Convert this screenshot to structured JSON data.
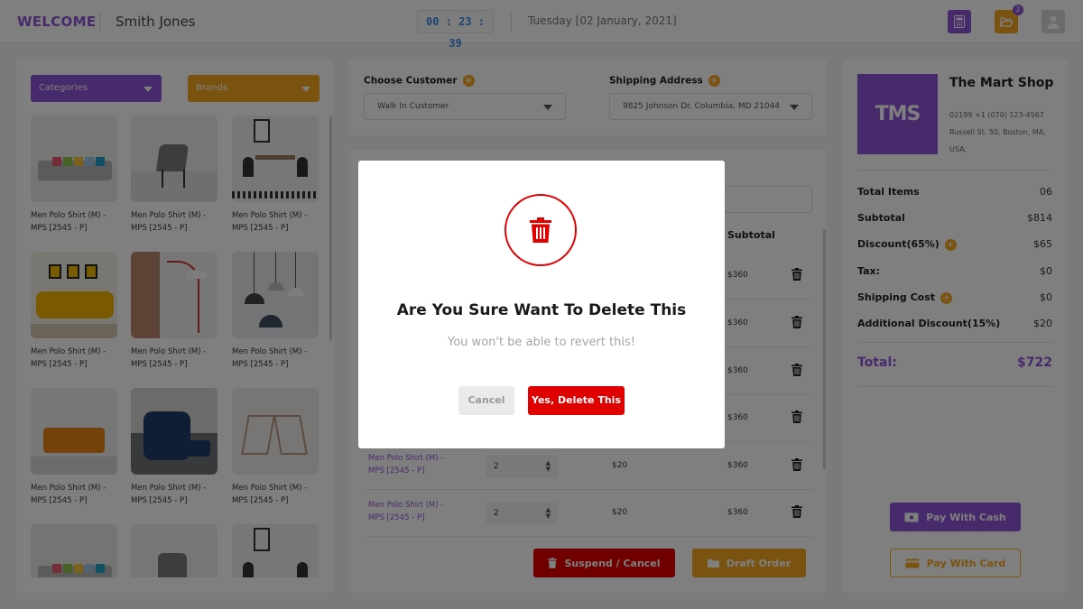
{
  "header": {
    "welcome": "WELCOME",
    "user_name": "Smith Jones",
    "timer": "00 : 23 : 39",
    "date": "Tuesday [02 January, 2021]",
    "folder_badge": "2"
  },
  "filters": {
    "categories": "Categories",
    "brands": "Brands"
  },
  "products": [
    {
      "name_line1": "Men Polo Shirt (M) -",
      "name_line2": "MPS [2545 - P]",
      "image": "grey-sofa"
    },
    {
      "name_line1": "Men Polo Shirt (M) -",
      "name_line2": "MPS [2545 - P]",
      "image": "grey-chair"
    },
    {
      "name_line1": "Men Polo Shirt (M) -",
      "name_line2": "MPS [2545 - P]",
      "image": "dining-table"
    },
    {
      "name_line1": "Men Polo Shirt (M) -",
      "name_line2": "MPS [2545 - P]",
      "image": "yellow-sofa"
    },
    {
      "name_line1": "Men Polo Shirt (M) -",
      "name_line2": "MPS [2545 - P]",
      "image": "floor-lamp"
    },
    {
      "name_line1": "Men Polo Shirt (M) -",
      "name_line2": "MPS [2545 - P]",
      "image": "pendant-lamps"
    },
    {
      "name_line1": "Men Polo Shirt (M) -",
      "name_line2": "MPS [2545 - P]",
      "image": "orange-sofa"
    },
    {
      "name_line1": "Men Polo Shirt (M) -",
      "name_line2": "MPS [2545 - P]",
      "image": "blue-armchair"
    },
    {
      "name_line1": "Men Polo Shirt (M) -",
      "name_line2": "MPS [2545 - P]",
      "image": "wire-chairs"
    },
    {
      "name_line1": "",
      "name_line2": "",
      "image": "grey-sofa"
    },
    {
      "name_line1": "",
      "name_line2": "",
      "image": "grey-chair"
    },
    {
      "name_line1": "",
      "name_line2": "",
      "image": "dining-table"
    }
  ],
  "customer": {
    "label": "Choose Customer",
    "value": "Walk In Customer"
  },
  "shipping": {
    "label": "Shipping Address",
    "value": "9825 Johnson Dr. Columbia, MD 21044"
  },
  "cart": {
    "subtotal_header": "Subtotal",
    "rows": [
      {
        "name_line1": "",
        "name_line2": "",
        "qty": "",
        "price": "",
        "subtotal": "$360"
      },
      {
        "name_line1": "",
        "name_line2": "",
        "qty": "",
        "price": "",
        "subtotal": "$360"
      },
      {
        "name_line1": "",
        "name_line2": "",
        "qty": "",
        "price": "",
        "subtotal": "$360"
      },
      {
        "name_line1": "",
        "name_line2": "",
        "qty": "",
        "price": "",
        "subtotal": "$360"
      },
      {
        "name_line1": "Men Polo Shirt (M) -",
        "name_line2": "MPS [2545 - P]",
        "qty": "2",
        "price": "$20",
        "subtotal": "$360"
      },
      {
        "name_line1": "Men Polo Shirt (M) -",
        "name_line2": "MPS [2545 - P]",
        "qty": "2",
        "price": "$20",
        "subtotal": "$360"
      }
    ],
    "suspend_label": "Suspend / Cancel",
    "draft_label": "Draft Order"
  },
  "shop": {
    "logo_text": "TMS",
    "name": "The Mart Shop",
    "phone": "02199 +1 (070) 123-4567",
    "address_line1": "Russell St. 50, Boston, MA,",
    "address_line2": "USA,"
  },
  "summary": {
    "total_items_label": "Total Items",
    "total_items": "06",
    "subtotal_label": "Subtotal",
    "subtotal": "$814",
    "discount_label": "Discount(65%)",
    "discount": "$65",
    "tax_label": "Tax:",
    "tax": "$0",
    "shipping_label": "Shipping Cost",
    "shipping": "$0",
    "additional_label": "Additional Discount(15%)",
    "additional": "$20",
    "total_label": "Total:",
    "total": "$722"
  },
  "payment": {
    "cash_label": "Pay With Cash",
    "card_label": "Pay With Card"
  },
  "modal": {
    "title": "Are You Sure Want To Delete This",
    "subtitle": "You won't be able to revert this!",
    "cancel_label": "Cancel",
    "confirm_label": "Yes, Delete This"
  },
  "colors": {
    "primary": "#8e54d6",
    "accent": "#f5a623",
    "danger": "#e00000"
  }
}
